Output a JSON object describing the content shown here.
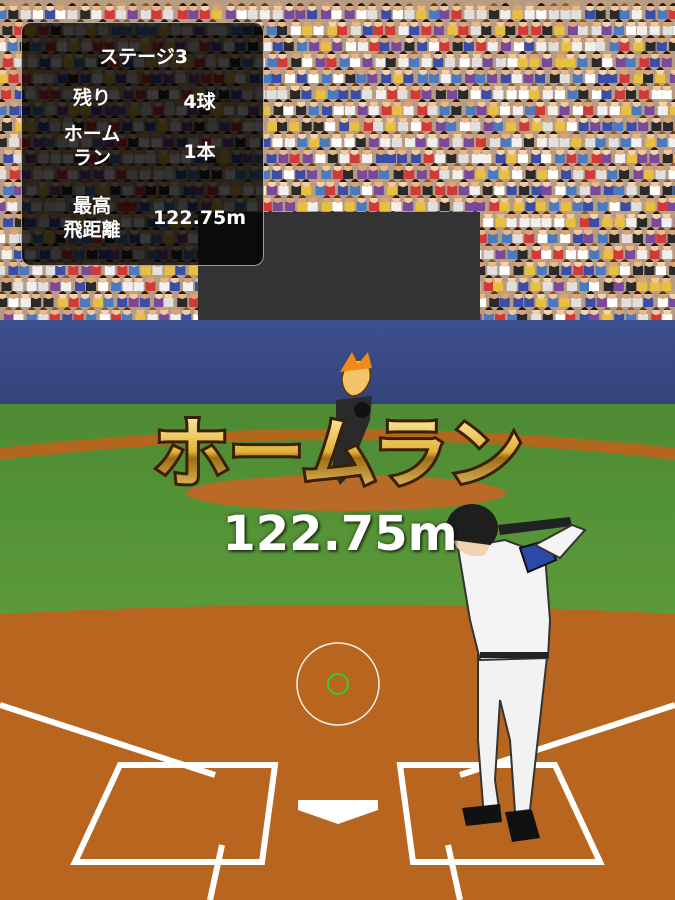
{
  "scoreboard": {
    "stage": "ステージ3",
    "remaining_label": "残り",
    "remaining_value": "4球",
    "homerun_label_line1": "ホーム",
    "homerun_label_line2": "ラン",
    "homerun_value": "1本",
    "best_label_line1": "最高",
    "best_label_line2": "飛距離",
    "best_value": "122.75m"
  },
  "result": {
    "title": "ホームラン",
    "distance": "122.75m"
  },
  "colors": {
    "sky_crowd": "#c9b29a",
    "wall": "#3a4d8c",
    "grass": "#4e8a34",
    "dirt": "#b8651e",
    "title_gold": "#c9961e",
    "title_outline": "#3b1f06"
  }
}
